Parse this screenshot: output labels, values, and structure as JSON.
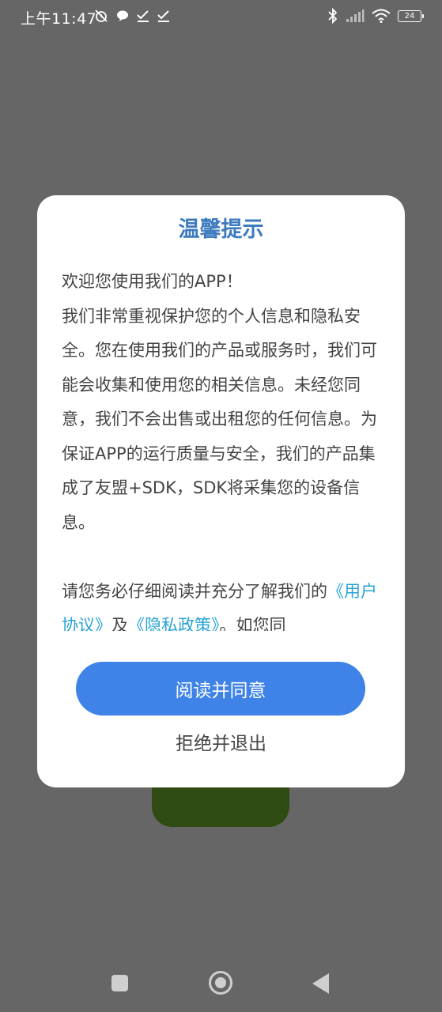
{
  "status_bar": {
    "time": "上午11:47",
    "battery": "24"
  },
  "dialog": {
    "title": "温馨提示",
    "paragraph1": "欢迎您使用我们的APP！",
    "paragraph2": "我们非常重视保护您的个人信息和隐私安全。您在使用我们的产品或服务时，我们可能会收集和使用您的相关信息。未经您同意，我们不会出售或出租您的任何信息。为保证APP的运行质量与安全，我们的产品集成了友盟+SDK，SDK将采集您的设备信息。",
    "paragraph3_prefix": "请您务必仔细阅读并充分了解我们的",
    "user_agreement_link": "《用户协议》",
    "conjunction": "及",
    "privacy_policy_link": "《隐私政策》",
    "paragraph3_suffix": "。如您同"
  },
  "buttons": {
    "agree": "阅读并同意",
    "reject": "拒绝并退出"
  },
  "colors": {
    "title": "#3d7bbf",
    "link": "#27a3d6",
    "primary_button": "#3f83e8",
    "overlay": "#666666"
  }
}
